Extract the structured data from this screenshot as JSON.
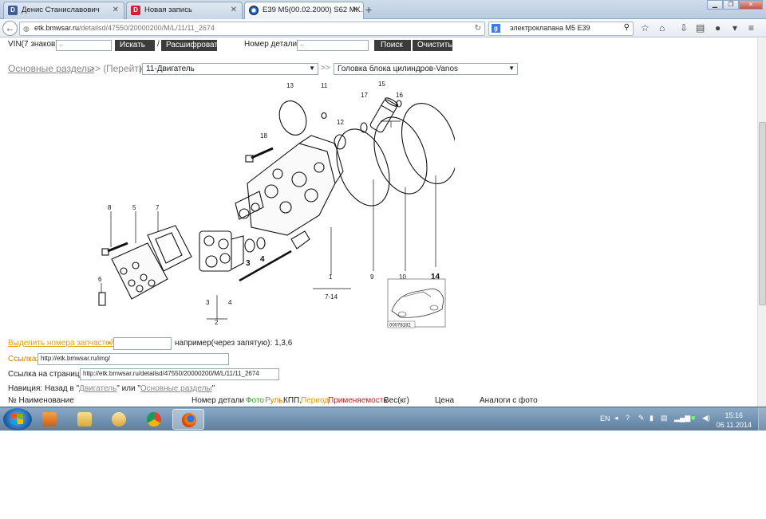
{
  "browser": {
    "tabs": [
      {
        "label": "Денис Станиславович",
        "favicon": "D",
        "color": "#3d5a99",
        "active": false
      },
      {
        "label": "Новая запись",
        "favicon": "D",
        "color": "#cc2233",
        "active": false
      },
      {
        "label": "E39 M5(00.02.2000) S62 МК...",
        "favicon": "bmw",
        "color": "#1c69d4",
        "active": true
      }
    ],
    "url_host": "etk.bmwsar.ru",
    "url_path": "/detailsd/47550/20000200/M/L/11/11_2674",
    "search_engine": "g",
    "search_text": "электроклапана М5 Е39"
  },
  "search": {
    "vin_label": "VIN(7 знаков):",
    "vin_value": "··",
    "find_button": "Искать",
    "separator": "/",
    "decode_button": "Расшифровать",
    "part_label": "Номер детали:",
    "part_value": "··",
    "search_button": "Поиск",
    "clear_button": "Очистить"
  },
  "breadcrumb": {
    "main_sections": "Основные разделы",
    "arrows1": ">> (",
    "goto": "Перейти",
    "arrows1b": ")",
    "group_select": "11-Двигатель",
    "arrows2": ">>",
    "subgroup_select": "Головка блока цилиндров-Vanos"
  },
  "diagram": {
    "labels": [
      "13",
      "11",
      "15",
      "17",
      "16",
      "12",
      "18",
      "8",
      "5",
      "7",
      "6",
      "1",
      "3",
      "4",
      "2",
      "9",
      "10",
      "14",
      "7-14",
      "3",
      "4"
    ],
    "image_code": "00078182"
  },
  "highlight": {
    "link": "Выделить номера запчастей",
    "dash": "-",
    "hint": "например(через запятую): 1,3,6"
  },
  "link_row": {
    "label": "Ссылка:",
    "value": "http://etk.bmwsar.ru/img/"
  },
  "page_link_row": {
    "label": "Ссылка на страницу:",
    "value": "http://etk.bmwsar.ru/detailsd/47550/20000200/M/L/11/11_2674"
  },
  "navigation": {
    "prefix": "Навиция: Назад в \"",
    "engine_link": "Двигатель",
    "middle": "\" или \"",
    "sections_link": "Основные разделы",
    "suffix": "\""
  },
  "table": {
    "col_num_name": "№ Наименование",
    "col_part": "Номер детали",
    "col_photo": "Фото",
    "col_rudder": "Руль,",
    "col_kpp": "КПП,",
    "col_period": "Период",
    "col_applic": "Применяемость",
    "col_weight": "Вес(кг)",
    "col_price": "Цена",
    "col_analogs": "Аналоги с фото"
  },
  "taskbar": {
    "lang": "EN",
    "time": "15:16",
    "date": "06.11.2014"
  },
  "colors": {
    "photo": "#2a9a2a",
    "rudder": "#d08000",
    "period": "#e0a000",
    "applic": "#c02020",
    "link_orange": "#e0a000"
  }
}
